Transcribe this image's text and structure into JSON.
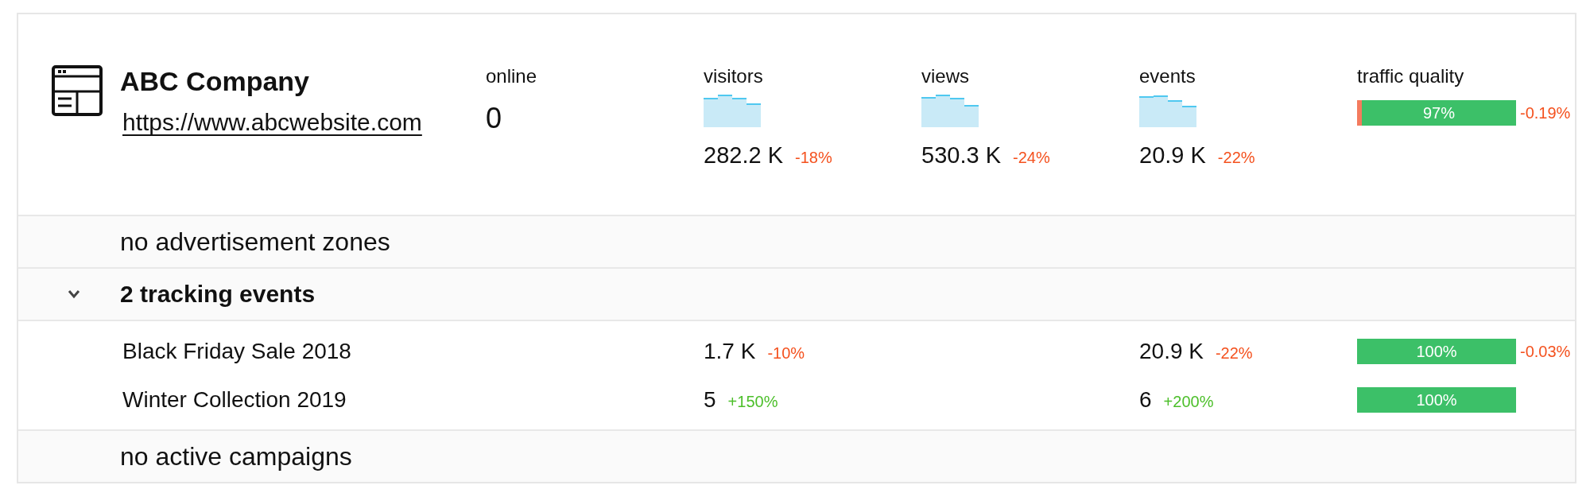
{
  "site": {
    "name": "ABC Company",
    "url": "https://www.abcwebsite.com"
  },
  "metrics": [
    {
      "kind": "count",
      "label": "online",
      "value": "0"
    },
    {
      "kind": "trend",
      "label": "visitors",
      "value": "282.2 K",
      "change": "-18%",
      "negative": true
    },
    {
      "kind": "trend",
      "label": "views",
      "value": "530.3 K",
      "change": "-24%",
      "negative": true
    },
    {
      "kind": "trend",
      "label": "events",
      "value": "20.9 K",
      "change": "-22%",
      "negative": true
    },
    {
      "kind": "quality",
      "label": "traffic quality",
      "level": 0.97,
      "reading": "97%",
      "change": "-0.19%",
      "negative": true
    }
  ],
  "sections": [
    {
      "kind": "empty",
      "label": "no advertisement zones"
    },
    {
      "kind": "group",
      "label": "2 tracking events",
      "expanded": true,
      "items": [
        {
          "name": "Black Friday Sale 2018",
          "visitors": {
            "value": "1.7 K",
            "change": "-10%",
            "negative": true
          },
          "events": {
            "value": "20.9 K",
            "change": "-22%",
            "negative": true
          },
          "quality": {
            "level": 1,
            "reading": "100%",
            "change": "-0.03%",
            "negative": true
          }
        },
        {
          "name": "Winter Collection 2019",
          "visitors": {
            "value": "5",
            "change": "+150%",
            "negative": false
          },
          "events": {
            "value": "6",
            "change": "+200%",
            "negative": false
          },
          "quality": {
            "level": 1,
            "reading": "100%"
          }
        }
      ]
    },
    {
      "kind": "empty",
      "label": "no active campaigns"
    }
  ]
}
